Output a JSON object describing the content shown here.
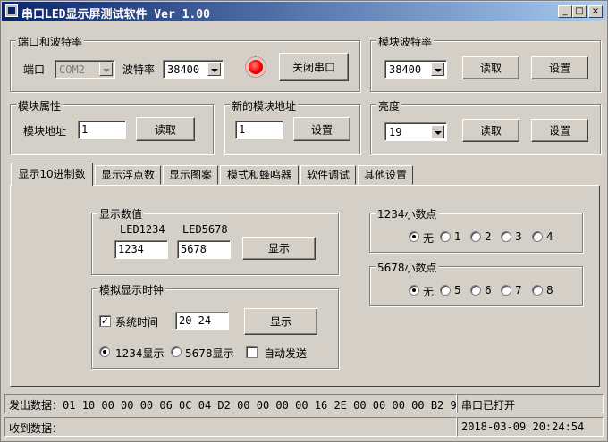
{
  "window": {
    "title": "串口LED显示屏测试软件 Ver 1.00",
    "controls": [
      "_",
      "□",
      "×"
    ]
  },
  "serial": {
    "group_title": "端口和波特率",
    "port_label": "端口",
    "port_value": "COM2",
    "baud_label": "波特率",
    "baud_value": "38400",
    "close_button": "关闭串口",
    "status_led_color": "#ff0000"
  },
  "module_baud": {
    "group_title": "模块波特率",
    "baud_value": "38400",
    "read_button": "读取",
    "set_button": "设置"
  },
  "module_props": {
    "group_title": "模块属性",
    "address_label": "模块地址",
    "address_value": "1",
    "read_button": "读取"
  },
  "new_address": {
    "group_title": "新的模块地址",
    "address_value": "1",
    "set_button": "设置"
  },
  "brightness": {
    "group_title": "亮度",
    "value": "19",
    "read_button": "读取",
    "set_button": "设置"
  },
  "tabs": [
    {
      "label": "显示10进制数",
      "active": true
    },
    {
      "label": "显示浮点数"
    },
    {
      "label": "显示图案"
    },
    {
      "label": "模式和蜂鸣器"
    },
    {
      "label": "软件调试"
    },
    {
      "label": "其他设置"
    }
  ],
  "display_value": {
    "group_title": "显示数值",
    "led1_label": "LED1234",
    "led2_label": "LED5678",
    "led1_value": "1234",
    "led2_value": "5678",
    "show_button": "显示"
  },
  "clock": {
    "group_title": "模拟显示时钟",
    "system_time_label": "系统时间",
    "system_time_checked": true,
    "time_value": "20 24",
    "show_button": "显示",
    "radio1_label": "1234显示",
    "radio2_label": "5678显示",
    "auto_send_label": "自动发送",
    "auto_send_checked": false
  },
  "dp1234": {
    "group_title": "1234小数点",
    "options": [
      "无",
      "1",
      "2",
      "3",
      "4"
    ],
    "selected": "无"
  },
  "dp5678": {
    "group_title": "5678小数点",
    "options": [
      "无",
      "5",
      "6",
      "7",
      "8"
    ],
    "selected": "无"
  },
  "statusbar": {
    "sent_label": "发出数据：",
    "sent_data": "01 10 00 00 00 06 0C 04 D2 00 00 00 00 16 2E 00 00 00 00 B2 93",
    "port_state": "串口已打开",
    "recv_label": "收到数据：",
    "recv_data": "",
    "datetime": "2018-03-09 20:24:54"
  }
}
